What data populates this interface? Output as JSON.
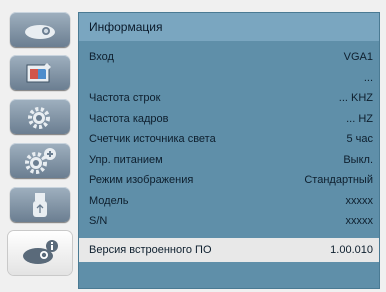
{
  "panel": {
    "title": "Информация",
    "rows": [
      {
        "label": "Вход",
        "value": "VGA1"
      },
      {
        "label": "",
        "value": "..."
      },
      {
        "label": "Частота строк",
        "value": "...  KHZ"
      },
      {
        "label": "Частота кадров",
        "value": "...  HZ"
      },
      {
        "label": "Счетчик источника света",
        "value": "5 час"
      },
      {
        "label": "Упр. питанием",
        "value": "Выкл."
      },
      {
        "label": "Режим изображения",
        "value": "Стандартный"
      },
      {
        "label": "Модель",
        "value": "xxxxx"
      },
      {
        "label": "S/N",
        "value": "xxxxx"
      },
      {
        "label": "Версия встроенного ПО",
        "value": "1.00.010"
      }
    ]
  },
  "tabs": [
    {
      "icon": "projector-icon"
    },
    {
      "icon": "picture-settings-icon"
    },
    {
      "icon": "gear-icon"
    },
    {
      "icon": "expanded-settings-icon"
    },
    {
      "icon": "usb-icon"
    },
    {
      "icon": "info-icon"
    }
  ],
  "colors": {
    "panel_bg": "#5f8fa9",
    "title_bg": "#7aa6c0",
    "tab_bg": "#7a8ea2",
    "selected_bg": "#e8e8e8"
  }
}
